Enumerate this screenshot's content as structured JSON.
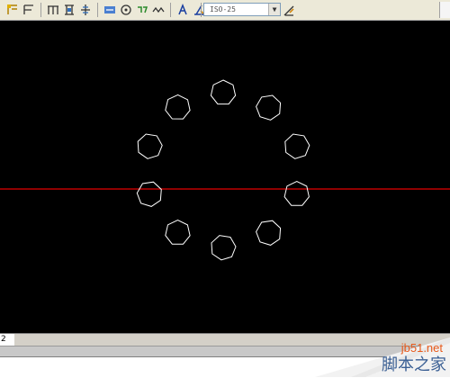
{
  "toolbar": {
    "dim_style_value": "ISO-25",
    "icons": [
      "dim-linear-icon",
      "dim-aligned-icon",
      "dim-baseline-icon",
      "dim-continue-icon",
      "dim-ordinate-icon",
      "dim-angular-icon",
      "dim-center-icon",
      "dim-tolerance-icon",
      "dim-jogged-icon",
      "dim-edit-text-icon",
      "dim-oblique-icon",
      "dim-update-icon",
      "dim-style-icon"
    ]
  },
  "canvas": {
    "background": "#000000",
    "axis_color": "#cc0000",
    "shape_color": "#ffffff"
  },
  "tabs": {
    "layout_tab_label": "2"
  },
  "watermark": {
    "site": "jb51.net",
    "brand": "脚本之家"
  }
}
